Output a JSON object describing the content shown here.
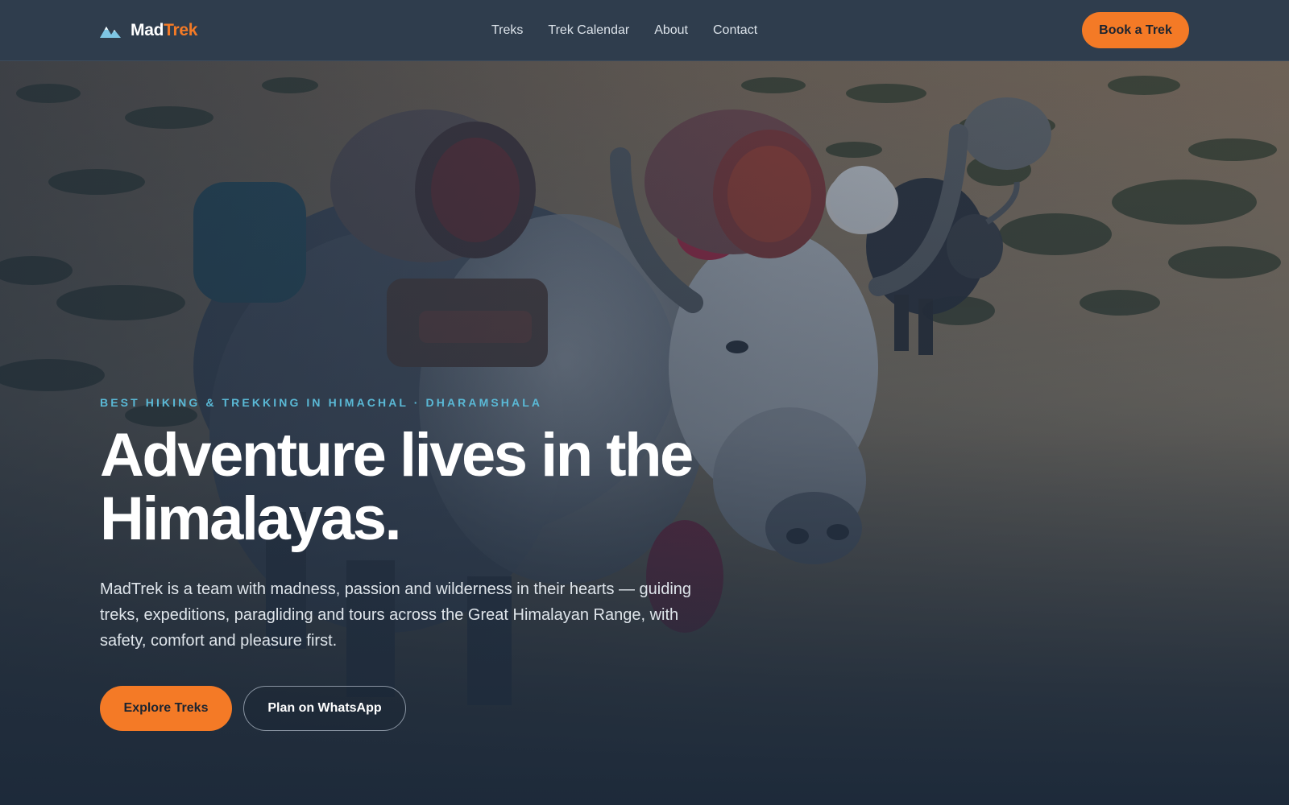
{
  "brand": {
    "name_part1": "Mad",
    "name_part2": "Trek",
    "icon": "mountain-icon"
  },
  "nav": {
    "links": [
      {
        "label": "Treks"
      },
      {
        "label": "Trek Calendar"
      },
      {
        "label": "About"
      },
      {
        "label": "Contact"
      }
    ],
    "cta_label": "Book a Trek"
  },
  "hero": {
    "eyebrow": "BEST HIKING & TREKKING IN HIMACHAL · DHARAMSHALA",
    "title_line1": "Adventure lives in the",
    "title_line2": "Himalayas.",
    "lead": "MadTrek is a team with madness, passion and wilderness in their hearts — guiding treks, expeditions, paragliding and tours across the Great Himalayan Range, with safety, comfort and pleasure first.",
    "primary_cta": "Explore Treks",
    "secondary_cta": "Plan on WhatsApp"
  },
  "colors": {
    "accent": "#f47a26",
    "nav_bg": "#2f3d4d",
    "eyebrow": "#5ab9d6",
    "hero_overlay": "#1d2a3a"
  }
}
